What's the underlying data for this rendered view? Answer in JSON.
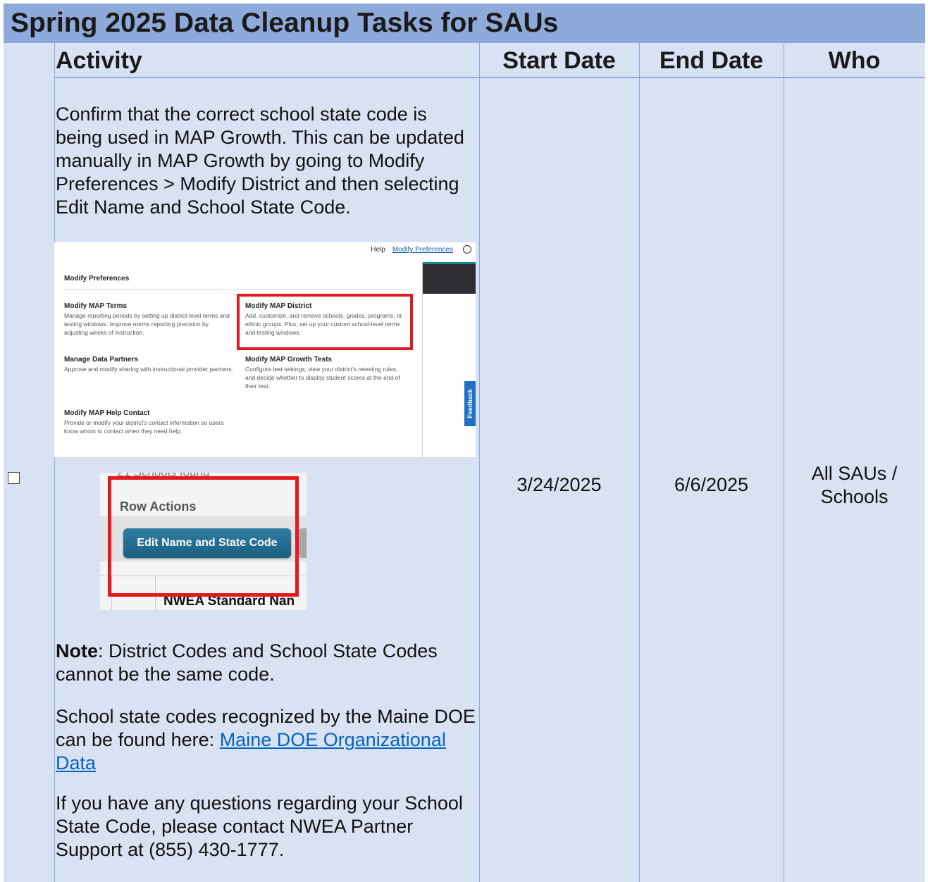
{
  "title": "Spring 2025 Data Cleanup Tasks for SAUs",
  "headers": {
    "activity": "Activity",
    "start": "Start Date",
    "end": "End Date",
    "who": "Who"
  },
  "row": {
    "intro": "Confirm that the correct school state code is being used in MAP Growth. This can be updated manually in MAP Growth by going to Modify Preferences > Modify District and then selecting Edit Name and School State Code.",
    "note_label": "Note",
    "note_text": ": District Codes and School State Codes cannot be the same code.",
    "codes_text": "School state codes recognized by the Maine DOE can be found here: ",
    "codes_link": "Maine DOE Organizational Data",
    "questions_text": "If you have any questions regarding your School State Code, please contact NWEA Partner Support at (855) 430-1777.",
    "start_date": "3/24/2025",
    "end_date": "6/6/2025",
    "who": "All SAUs / Schools"
  },
  "screenshot1": {
    "nav_help": "Help",
    "nav_pref": "Modify Preferences",
    "heading": "Modify Preferences",
    "items": [
      {
        "title": "Modify MAP Terms",
        "desc": "Manage reporting periods by setting up district-level terms and testing windows. Improve norms reporting precision by adjusting weeks of instruction."
      },
      {
        "title": "Modify MAP District",
        "desc": "Add, customize, and remove schools, grades, programs, or ethnic groups. Plus, set up your custom school-level terms and testing windows."
      },
      {
        "title": "Manage Data Partners",
        "desc": "Approve and modify sharing with instructional provider partners."
      },
      {
        "title": "Modify MAP Growth Tests",
        "desc": "Configure test settings, view your district's retesting rules, and decide whether to display student scores at the end of their test."
      },
      {
        "title": "Modify MAP Help Contact",
        "desc": "Provide or modify your district's contact information so users know whom to contact when they need help."
      }
    ],
    "feedback": "Feedback"
  },
  "screenshot2": {
    "cut_text": "21 Schools found",
    "row_actions": "Row Actions",
    "button": "Edit Name and State Code",
    "column": "NWEA Standard Nan"
  },
  "colors": {
    "title_band": "#8eaadb",
    "table_bg": "#d9e2f3",
    "link": "#0563c1",
    "highlight": "#e5191f"
  }
}
